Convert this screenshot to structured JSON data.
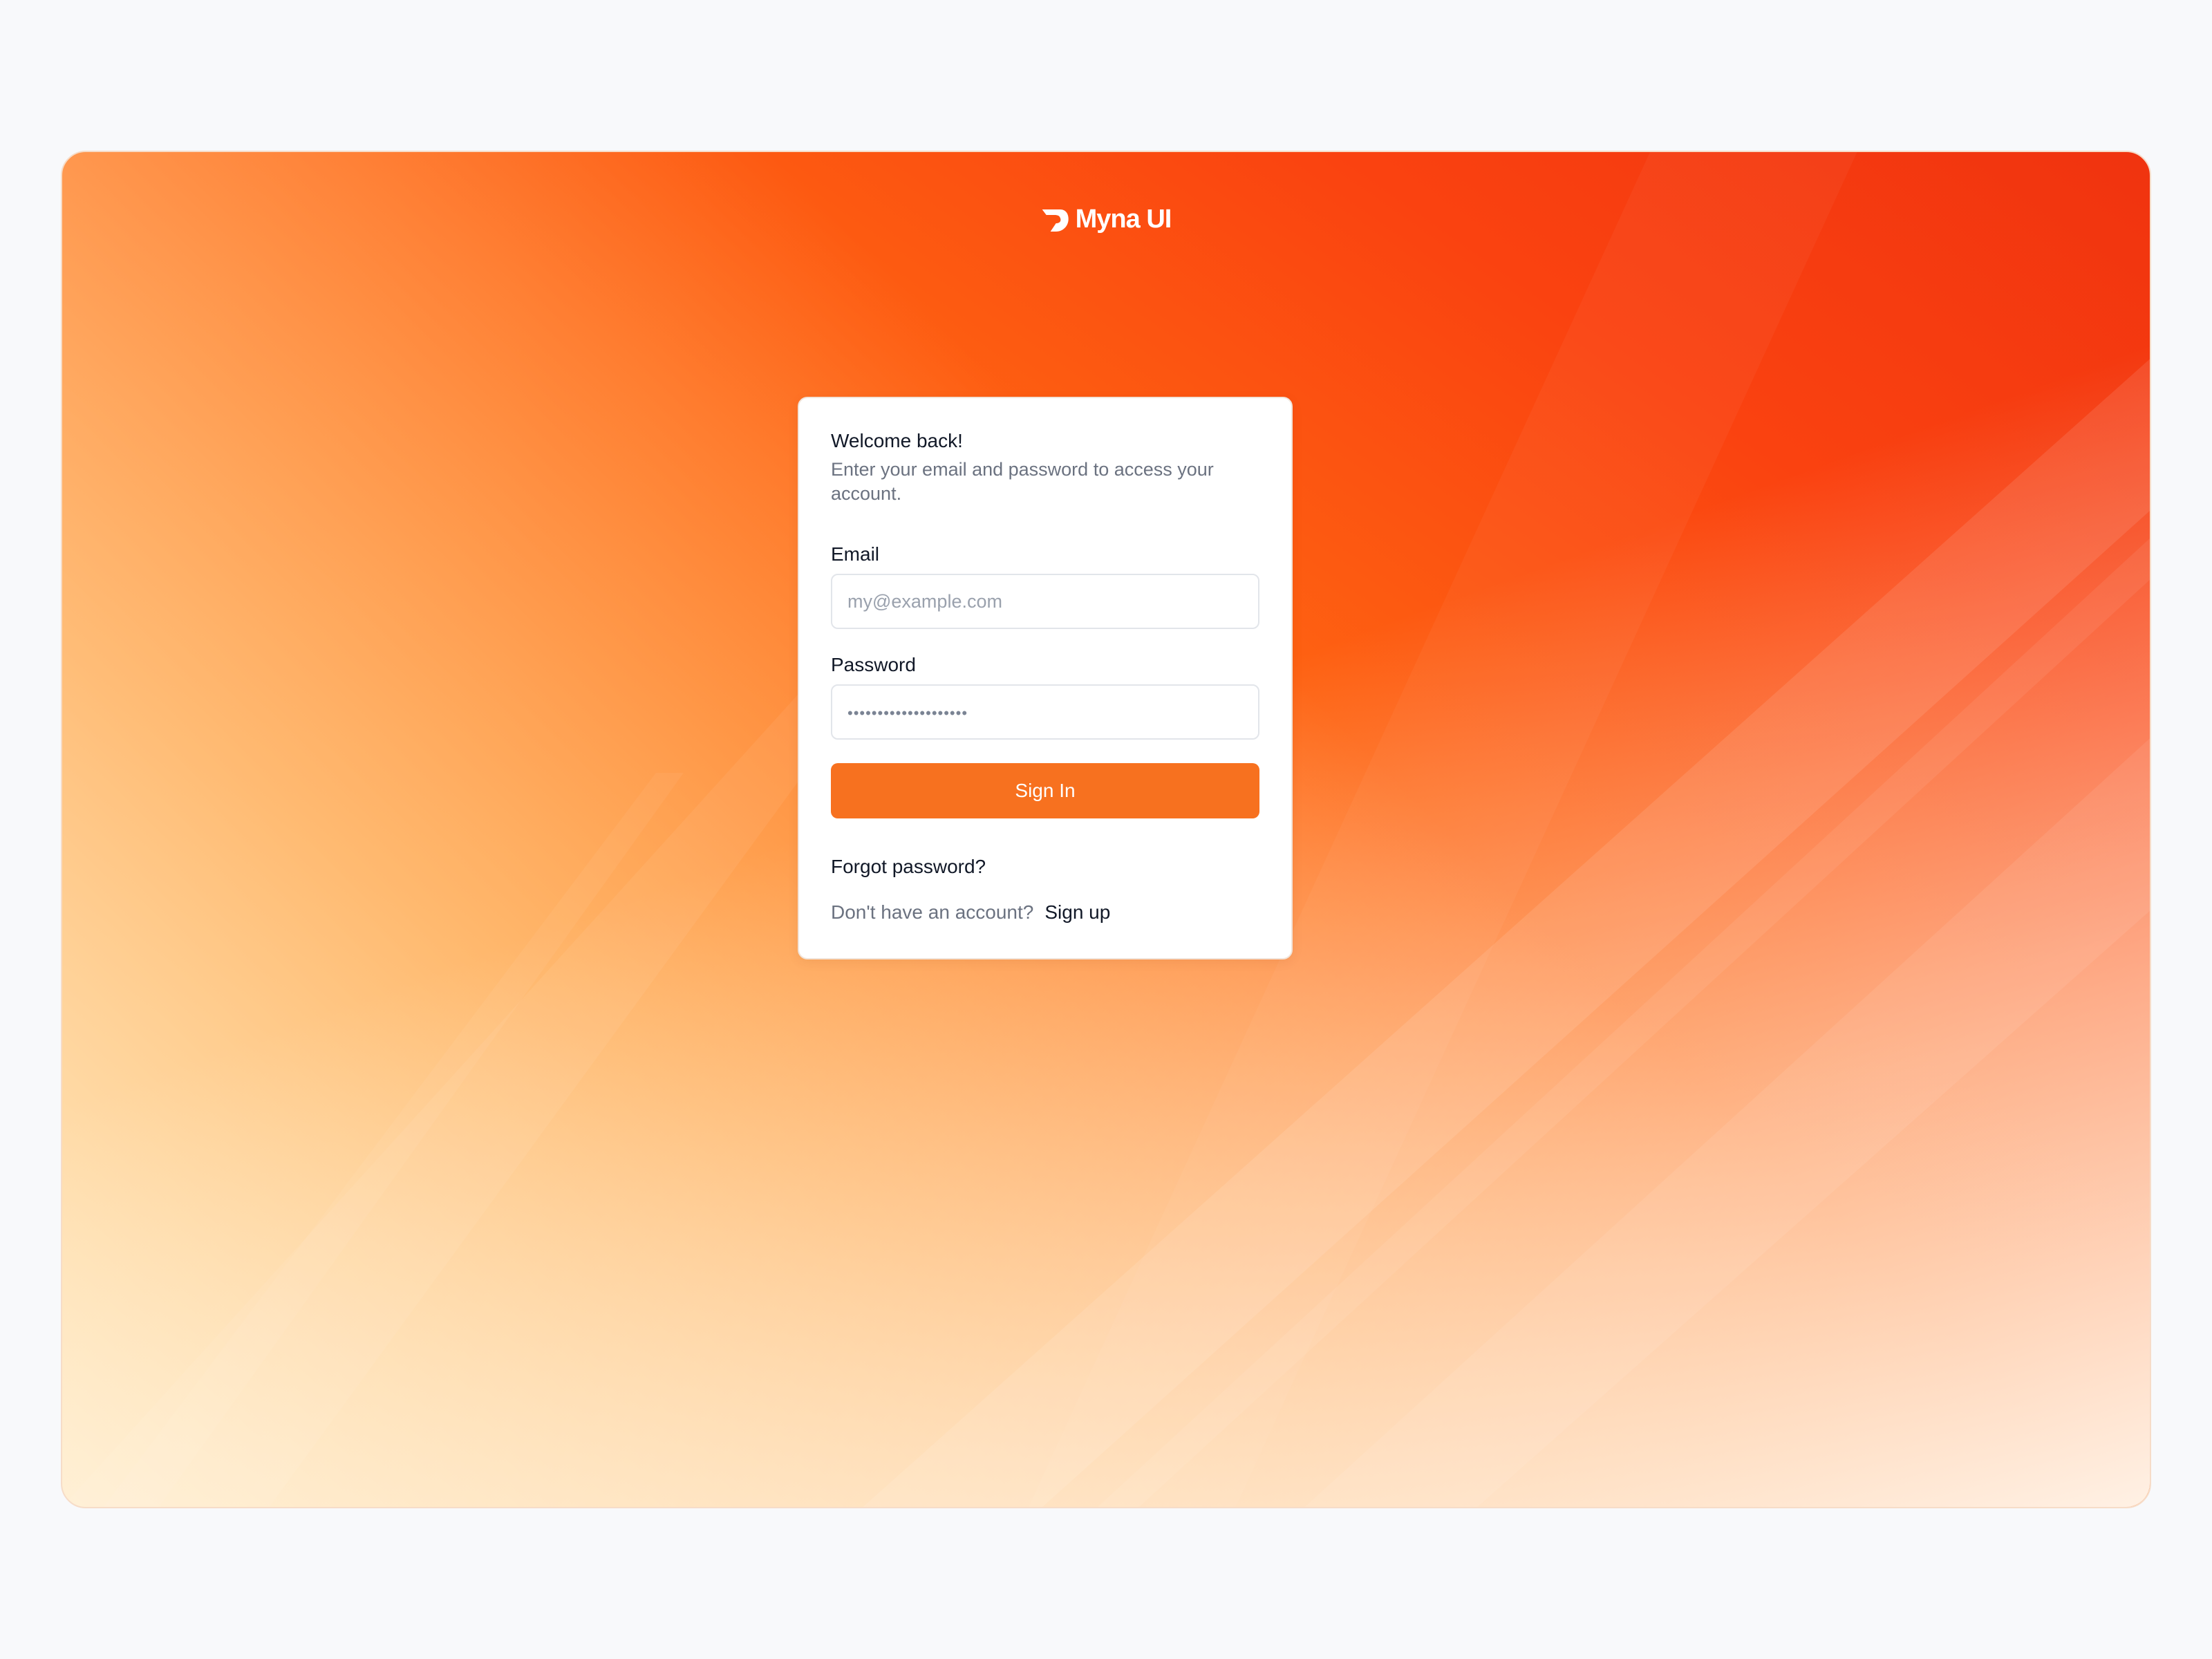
{
  "brand": {
    "name": "Myna UI",
    "icon": "myna-logo-icon"
  },
  "login_card": {
    "title": "Welcome back!",
    "subtitle": "Enter your email and password to access your account.",
    "email": {
      "label": "Email",
      "placeholder": "my@example.com",
      "value": ""
    },
    "password": {
      "label": "Password",
      "placeholder": "••••••••••••••••••••",
      "value": ""
    },
    "submit_label": "Sign In",
    "forgot_label": "Forgot password?",
    "signup_prompt": "Don't have an account?",
    "signup_label": "Sign up"
  },
  "colors": {
    "accent": "#f7711f",
    "page_background": "#f8f9fb",
    "gradient_start": "#f0330f",
    "gradient_mid": "#ff8a0e",
    "gradient_end": "#fff4e8"
  }
}
